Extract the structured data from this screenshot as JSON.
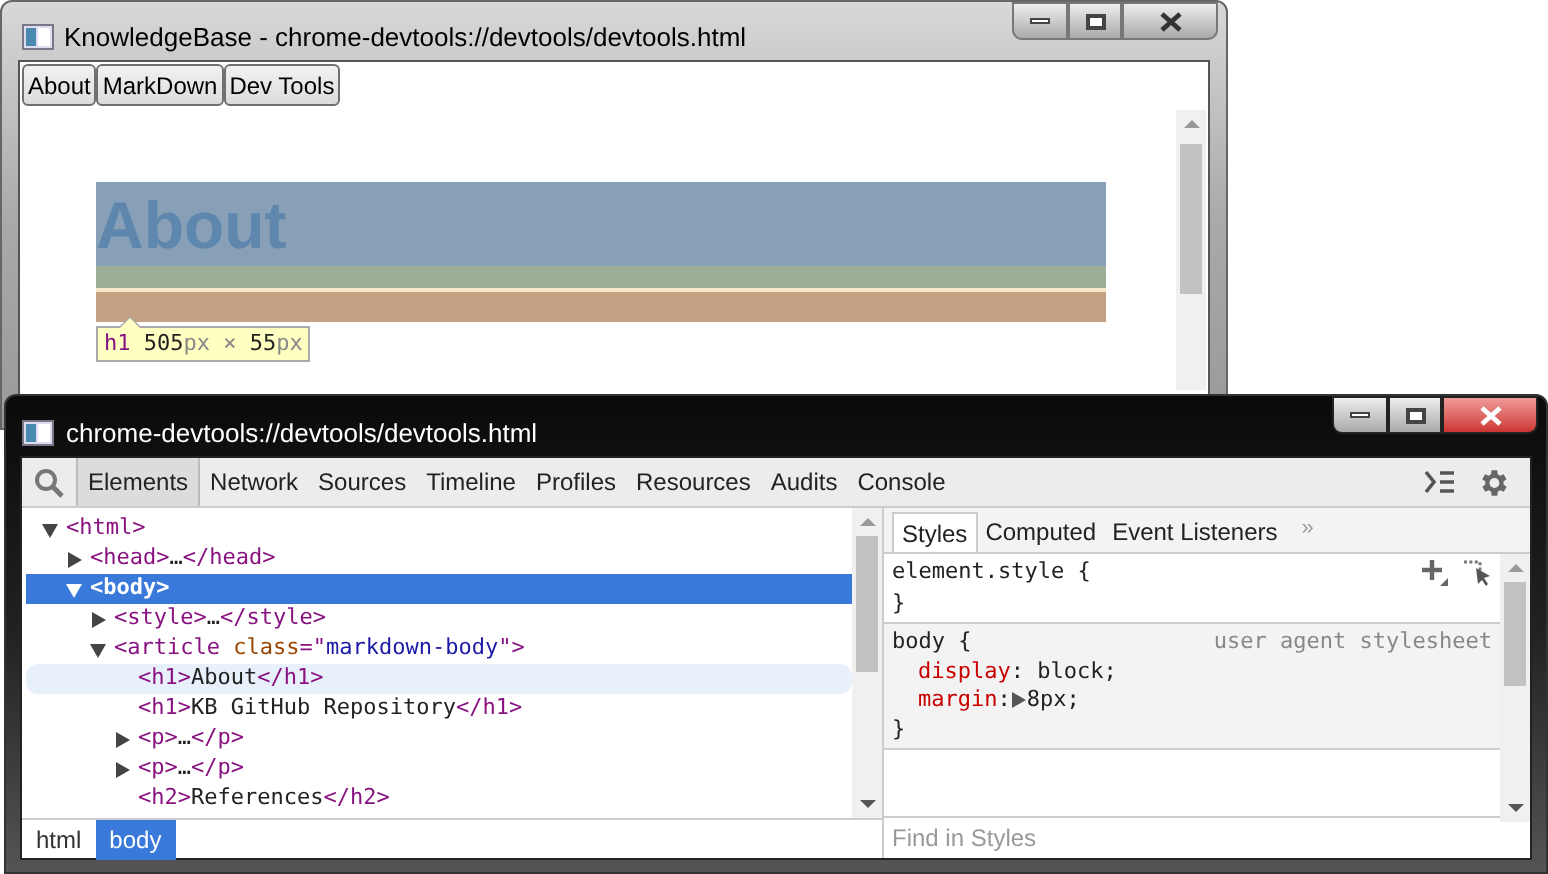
{
  "main_window": {
    "title": "KnowledgeBase - chrome-devtools://devtools/devtools.html",
    "tabs": [
      {
        "label": "About"
      },
      {
        "label": "MarkDown"
      },
      {
        "label": "Dev Tools"
      }
    ],
    "page": {
      "heading": "About",
      "tooltip": [
        {
          "kind": "tag",
          "text": "h1"
        },
        {
          "kind": "number",
          "text": " 505"
        },
        {
          "kind": "unit",
          "text": "px"
        },
        {
          "kind": "unit",
          "text": " × "
        },
        {
          "kind": "number",
          "text": "55"
        },
        {
          "kind": "unit",
          "text": "px"
        }
      ]
    }
  },
  "devtools": {
    "title": "chrome-devtools://devtools/devtools.html",
    "panels": [
      {
        "label": "Elements",
        "selected": true
      },
      {
        "label": "Network",
        "selected": false
      },
      {
        "label": "Sources",
        "selected": false
      },
      {
        "label": "Timeline",
        "selected": false
      },
      {
        "label": "Profiles",
        "selected": false
      },
      {
        "label": "Resources",
        "selected": false
      },
      {
        "label": "Audits",
        "selected": false
      },
      {
        "label": "Console",
        "selected": false
      }
    ],
    "tree": [
      {
        "kind": "branch",
        "expanded": true,
        "selected": false,
        "hovered": false,
        "segments": [
          {
            "kind": "tag",
            "text": "<html>"
          }
        ],
        "children": [
          {
            "kind": "branch",
            "expanded": false,
            "selected": false,
            "hovered": false,
            "segments": [
              {
                "kind": "tag",
                "text": "<head>"
              },
              {
                "kind": "text",
                "text": "…"
              },
              {
                "kind": "tag",
                "text": "</head>"
              }
            ]
          },
          {
            "kind": "branch",
            "expanded": true,
            "selected": true,
            "hovered": false,
            "segments": [
              {
                "kind": "tag",
                "text": "<body>"
              }
            ],
            "children": [
              {
                "kind": "branch",
                "expanded": false,
                "selected": false,
                "hovered": false,
                "segments": [
                  {
                    "kind": "tag",
                    "text": "<style>"
                  },
                  {
                    "kind": "text",
                    "text": "…"
                  },
                  {
                    "kind": "tag",
                    "text": "</style>"
                  }
                ]
              },
              {
                "kind": "branch",
                "expanded": true,
                "selected": false,
                "hovered": false,
                "segments": [
                  {
                    "kind": "tag",
                    "text": "<article "
                  },
                  {
                    "kind": "attr",
                    "text": "class"
                  },
                  {
                    "kind": "tag",
                    "text": "=\""
                  },
                  {
                    "kind": "value",
                    "text": "markdown-body"
                  },
                  {
                    "kind": "tag",
                    "text": "\">"
                  }
                ],
                "children": [
                  {
                    "kind": "leaf",
                    "selected": false,
                    "hovered": true,
                    "segments": [
                      {
                        "kind": "tag",
                        "text": "<h1>"
                      },
                      {
                        "kind": "text",
                        "text": "About"
                      },
                      {
                        "kind": "tag",
                        "text": "</h1>"
                      }
                    ]
                  },
                  {
                    "kind": "leaf",
                    "selected": false,
                    "hovered": false,
                    "segments": [
                      {
                        "kind": "tag",
                        "text": "<h1>"
                      },
                      {
                        "kind": "text",
                        "text": "KB GitHub Repository"
                      },
                      {
                        "kind": "tag",
                        "text": "</h1>"
                      }
                    ]
                  },
                  {
                    "kind": "branch",
                    "expanded": false,
                    "selected": false,
                    "hovered": false,
                    "segments": [
                      {
                        "kind": "tag",
                        "text": "<p>"
                      },
                      {
                        "kind": "text",
                        "text": "…"
                      },
                      {
                        "kind": "tag",
                        "text": "</p>"
                      }
                    ]
                  },
                  {
                    "kind": "branch",
                    "expanded": false,
                    "selected": false,
                    "hovered": false,
                    "segments": [
                      {
                        "kind": "tag",
                        "text": "<p>"
                      },
                      {
                        "kind": "text",
                        "text": "…"
                      },
                      {
                        "kind": "tag",
                        "text": "</p>"
                      }
                    ]
                  },
                  {
                    "kind": "leaf",
                    "selected": false,
                    "hovered": false,
                    "segments": [
                      {
                        "kind": "tag",
                        "text": "<h2>"
                      },
                      {
                        "kind": "text",
                        "text": "References"
                      },
                      {
                        "kind": "tag",
                        "text": "</h2>"
                      }
                    ]
                  }
                ]
              }
            ]
          }
        ]
      }
    ],
    "breadcrumbs": [
      {
        "label": "html",
        "selected": false
      },
      {
        "label": "body",
        "selected": true
      }
    ],
    "sidebar_tabs": [
      {
        "label": "Styles",
        "selected": true
      },
      {
        "label": "Computed",
        "selected": false
      },
      {
        "label": "Event Listeners",
        "selected": false
      }
    ],
    "more": "»",
    "rules": [
      {
        "selector": "element.style",
        "open": " {",
        "close": "}",
        "tools": true
      },
      {
        "selector": "body",
        "open": " {",
        "source": "user agent stylesheet",
        "close": "}",
        "tools": false,
        "properties": [
          {
            "name": "display",
            "colon": ":",
            "value": " block;",
            "expandable": false
          },
          {
            "name": "margin",
            "colon": ":",
            "value": "8px;",
            "expandable": true
          }
        ]
      }
    ],
    "filter": {
      "placeholder": "Find in Styles"
    }
  }
}
